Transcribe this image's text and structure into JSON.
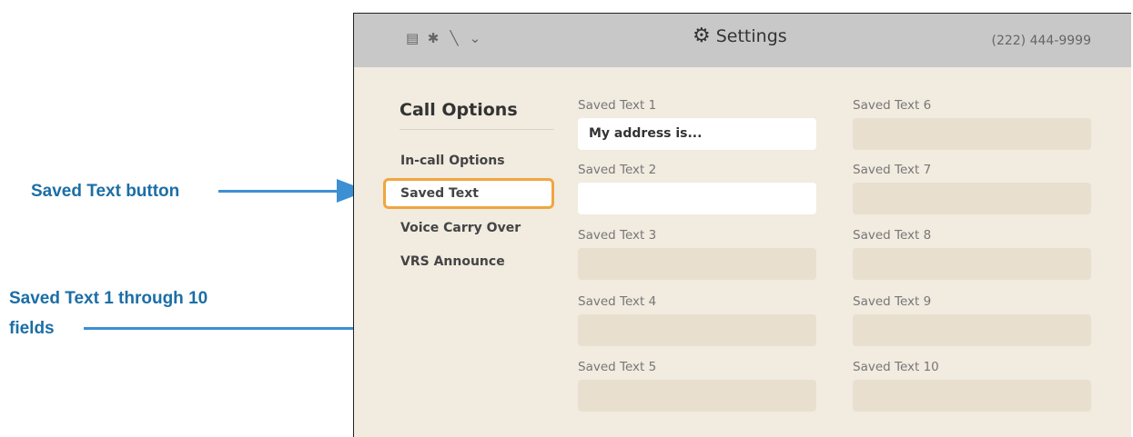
{
  "header": {
    "status_icons": [
      "monitor-icon",
      "bluetooth-icon",
      "network-off-icon",
      "mic-muted-icon"
    ],
    "title": "Settings",
    "phone": "(222) 444-9999"
  },
  "sidebar": {
    "title": "Call Options",
    "items": [
      {
        "label": "In-call Options",
        "selected": false
      },
      {
        "label": "Saved Text",
        "selected": true
      },
      {
        "label": "Voice Carry Over",
        "selected": false
      },
      {
        "label": "VRS Announce",
        "selected": false
      }
    ]
  },
  "saved_texts": [
    {
      "label": "Saved Text 1",
      "value": "My address is..."
    },
    {
      "label": "Saved Text 2",
      "value": ""
    },
    {
      "label": "Saved Text 3",
      "value": ""
    },
    {
      "label": "Saved Text 4",
      "value": ""
    },
    {
      "label": "Saved Text 5",
      "value": ""
    },
    {
      "label": "Saved Text 6",
      "value": ""
    },
    {
      "label": "Saved Text 7",
      "value": ""
    },
    {
      "label": "Saved Text 8",
      "value": ""
    },
    {
      "label": "Saved Text 9",
      "value": ""
    },
    {
      "label": "Saved Text 10",
      "value": ""
    }
  ],
  "annotations": {
    "saved_text_button": "Saved Text button",
    "fields_line1": "Saved Text 1 through 10",
    "fields_line2": "fields"
  },
  "colors": {
    "accent": "#f0a640",
    "annotation": "#1b6ea6",
    "arrow": "#3d8fd4"
  }
}
